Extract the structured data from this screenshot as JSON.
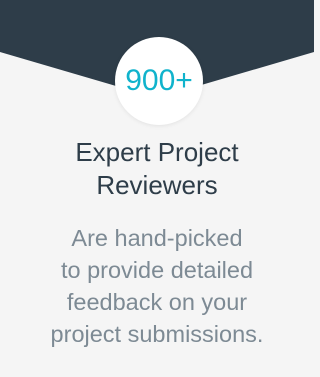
{
  "colors": {
    "header_band": "#2e3d49",
    "badge_text": "#10b3cc",
    "title_text": "#2e3d49",
    "description_text": "#7d8a94",
    "background": "#f5f5f5"
  },
  "stat": {
    "value": "900+"
  },
  "title": {
    "line1": "Expert Project",
    "line2": "Reviewers"
  },
  "description": {
    "line1": "Are hand-picked",
    "line2": "to provide detailed",
    "line3": "feedback on your",
    "line4": "project submissions."
  }
}
